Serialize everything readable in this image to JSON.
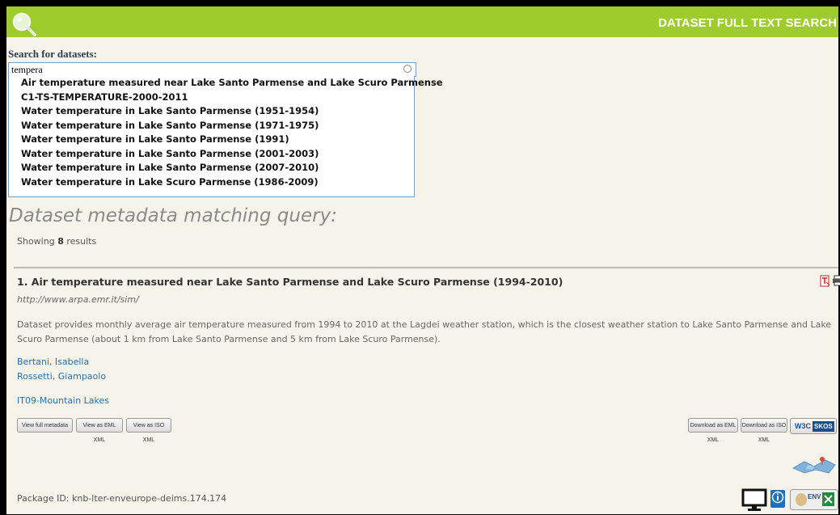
{
  "header": {
    "title": "DATASET FULL TEXT SEARCH",
    "logo_icon": "magnifier-icon"
  },
  "search": {
    "label": "Search for datasets:",
    "value": "tempera",
    "suggestions": [
      "Air temperature measured near Lake Santo Parmense and Lake Scuro Parmense",
      "C1-TS-TEMPERATURE-2000-2011",
      "Water temperature in Lake Santo Parmense (1951-1954)",
      "Water temperature in Lake Santo Parmense (1971-1975)",
      "Water temperature in Lake Santo Parmense (1991)",
      "Water temperature in Lake Santo Parmense (2001-2003)",
      "Water temperature in Lake Santo Parmense (2007-2010)",
      "Water temperature in Lake Scuro Parmense (1986-2009)"
    ]
  },
  "results": {
    "heading": "Dataset metadata matching query:",
    "showing_prefix": "Showing",
    "count": "8",
    "showing_suffix": "results",
    "first": {
      "title": "1. Air temperature measured near Lake Santo Parmense and Lake Scuro Parmense (1994-2010)",
      "url": "http://www.arpa.emr.it/sim/",
      "description": "Dataset provides monthly average air temperature measured from 1994 to 2010 at the Lagdei weather station, which is the closest weather station to Lake Santo Parmense and Lake Scuro Parmense (about 1 km from Lake Santo Parmense and 5 km from Lake Scuro Parmense).",
      "authors": [
        "Bertani, Isabella",
        "Rossetti, Giampaolo"
      ],
      "site": "IT09-Mountain Lakes",
      "buttons_left": [
        "View full metadata",
        "View as EML XML",
        "View as ISO XML"
      ],
      "buttons_right": [
        "Download as EML XML",
        "Download as ISO XML"
      ],
      "skos": {
        "w3c": "W3C",
        "label": "SKOS"
      },
      "package_id": "Package ID: knb-lter-enveurope-deims.174.174",
      "env_badge": "ENV"
    }
  },
  "colors": {
    "header_green": "#9dcc2c",
    "link_blue": "#2a6fa8",
    "heading_gray": "#8a8a8a"
  }
}
